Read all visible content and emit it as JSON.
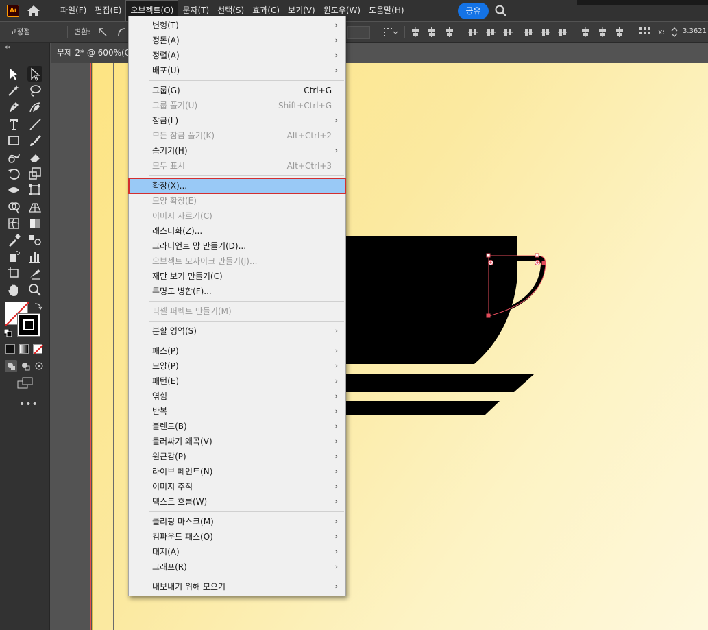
{
  "app": {
    "logo_text": "Ai"
  },
  "menubar": {
    "items": [
      "파일(F)",
      "편집(E)",
      "오브젝트(O)",
      "문자(T)",
      "선택(S)",
      "효과(C)",
      "보기(V)",
      "윈도우(W)",
      "도움말(H)"
    ],
    "active_index": 2,
    "share_label": "공유"
  },
  "controlbar": {
    "anchor_label": "고정점",
    "convert_label": "변환:",
    "coord_label": "x:",
    "coord_value": "3.3621"
  },
  "document": {
    "tab_title": "무제-2* @ 600%(C"
  },
  "object_menu": {
    "items": [
      {
        "label": "변형(T)",
        "submenu": true
      },
      {
        "label": "정돈(A)",
        "submenu": true
      },
      {
        "label": "정렬(A)",
        "submenu": true
      },
      {
        "label": "배포(U)",
        "submenu": true
      },
      {
        "separator": true
      },
      {
        "label": "그룹(G)",
        "shortcut": "Ctrl+G"
      },
      {
        "label": "그룹 풀기(U)",
        "shortcut": "Shift+Ctrl+G",
        "disabled": true
      },
      {
        "label": "잠금(L)",
        "submenu": true
      },
      {
        "label": "모든 잠금 풀기(K)",
        "shortcut": "Alt+Ctrl+2",
        "disabled": true
      },
      {
        "label": "숨기기(H)",
        "submenu": true
      },
      {
        "label": "모두 표시",
        "shortcut": "Alt+Ctrl+3",
        "disabled": true
      },
      {
        "separator": true
      },
      {
        "label": "확장(X)...",
        "highlighted": true
      },
      {
        "label": "모양 확장(E)",
        "disabled": true
      },
      {
        "label": "이미지 자르기(C)",
        "disabled": true
      },
      {
        "label": "래스터화(Z)..."
      },
      {
        "label": "그라디언트 망 만들기(D)..."
      },
      {
        "label": "오브젝트 모자이크 만들기(J)...",
        "disabled": true
      },
      {
        "label": "재단 보기 만들기(C)"
      },
      {
        "label": "투명도 병합(F)..."
      },
      {
        "separator": true
      },
      {
        "label": "픽셀 퍼펙트 만들기(M)",
        "disabled": true
      },
      {
        "separator": true
      },
      {
        "label": "분할 영역(S)",
        "submenu": true
      },
      {
        "separator": true
      },
      {
        "label": "패스(P)",
        "submenu": true
      },
      {
        "label": "모양(P)",
        "submenu": true
      },
      {
        "label": "패턴(E)",
        "submenu": true
      },
      {
        "label": "엮힘",
        "submenu": true
      },
      {
        "label": "반복",
        "submenu": true
      },
      {
        "label": "블렌드(B)",
        "submenu": true
      },
      {
        "label": "둘러싸기 왜곡(V)",
        "submenu": true
      },
      {
        "label": "원근감(P)",
        "submenu": true
      },
      {
        "label": "라이브 페인트(N)",
        "submenu": true
      },
      {
        "label": "이미지 추적",
        "submenu": true
      },
      {
        "label": "텍스트 흐름(W)",
        "submenu": true
      },
      {
        "separator": true
      },
      {
        "label": "클리핑 마스크(M)",
        "submenu": true
      },
      {
        "label": "컴파운드 패스(O)",
        "submenu": true
      },
      {
        "label": "대지(A)",
        "submenu": true
      },
      {
        "label": "그래프(R)",
        "submenu": true
      },
      {
        "separator": true
      },
      {
        "label": "내보내기 위해 모으기",
        "submenu": true
      }
    ]
  },
  "toolbar": {
    "tools": [
      "selection-tool",
      "direct-selection-tool",
      "magic-wand-tool",
      "lasso-tool",
      "pen-tool",
      "curvature-tool",
      "type-tool",
      "line-tool",
      "rectangle-tool",
      "paintbrush-tool",
      "shaper-tool",
      "eraser-tool",
      "rotate-tool",
      "scale-tool",
      "width-tool",
      "free-transform-tool",
      "shape-builder-tool",
      "perspective-grid-tool",
      "mesh-tool",
      "gradient-tool",
      "eyedropper-tool",
      "blend-tool",
      "symbol-sprayer-tool",
      "column-graph-tool",
      "artboard-tool",
      "slice-tool",
      "hand-tool",
      "zoom-tool"
    ]
  },
  "colors": {
    "accent": "#1473e6",
    "highlight": "#99c9f6",
    "highlight_border": "#d32f2f",
    "cup": "#000000"
  }
}
